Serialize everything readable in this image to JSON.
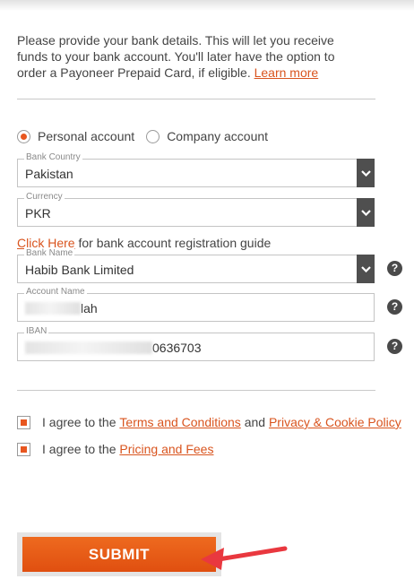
{
  "intro": {
    "text": "Please provide your bank details. This will let you receive funds to your bank account. You'll later have the option to order a Payoneer Prepaid Card, if eligible.",
    "learn_more": "Learn more"
  },
  "account_type": {
    "options": [
      "Personal account",
      "Company account"
    ],
    "selected": "Personal account"
  },
  "fields": {
    "bank_country": {
      "label": "Bank Country",
      "value": "Pakistan"
    },
    "currency": {
      "label": "Currency",
      "value": "PKR"
    },
    "bank_name": {
      "label": "Bank Name",
      "value": "Habib Bank Limited"
    },
    "account_name": {
      "label": "Account Name",
      "value_visible": "lah"
    },
    "iban": {
      "label": "IBAN",
      "value_visible": "0636703"
    }
  },
  "guide": {
    "link": "Click Here",
    "text": "for bank account registration guide"
  },
  "help_symbol": "?",
  "agreements": {
    "terms": {
      "prefix": "I agree to the",
      "terms_link": "Terms and Conditions",
      "and": "and",
      "privacy_link": "Privacy & Cookie Policy",
      "checked": true
    },
    "pricing": {
      "prefix": "I agree to the",
      "pricing_link": "Pricing and Fees",
      "checked": true
    }
  },
  "submit_label": "SUBMIT",
  "colors": {
    "accent": "#e8561f",
    "submit": "#e85b17",
    "arrow": "#e9383f",
    "dark": "#4f4f4f"
  }
}
